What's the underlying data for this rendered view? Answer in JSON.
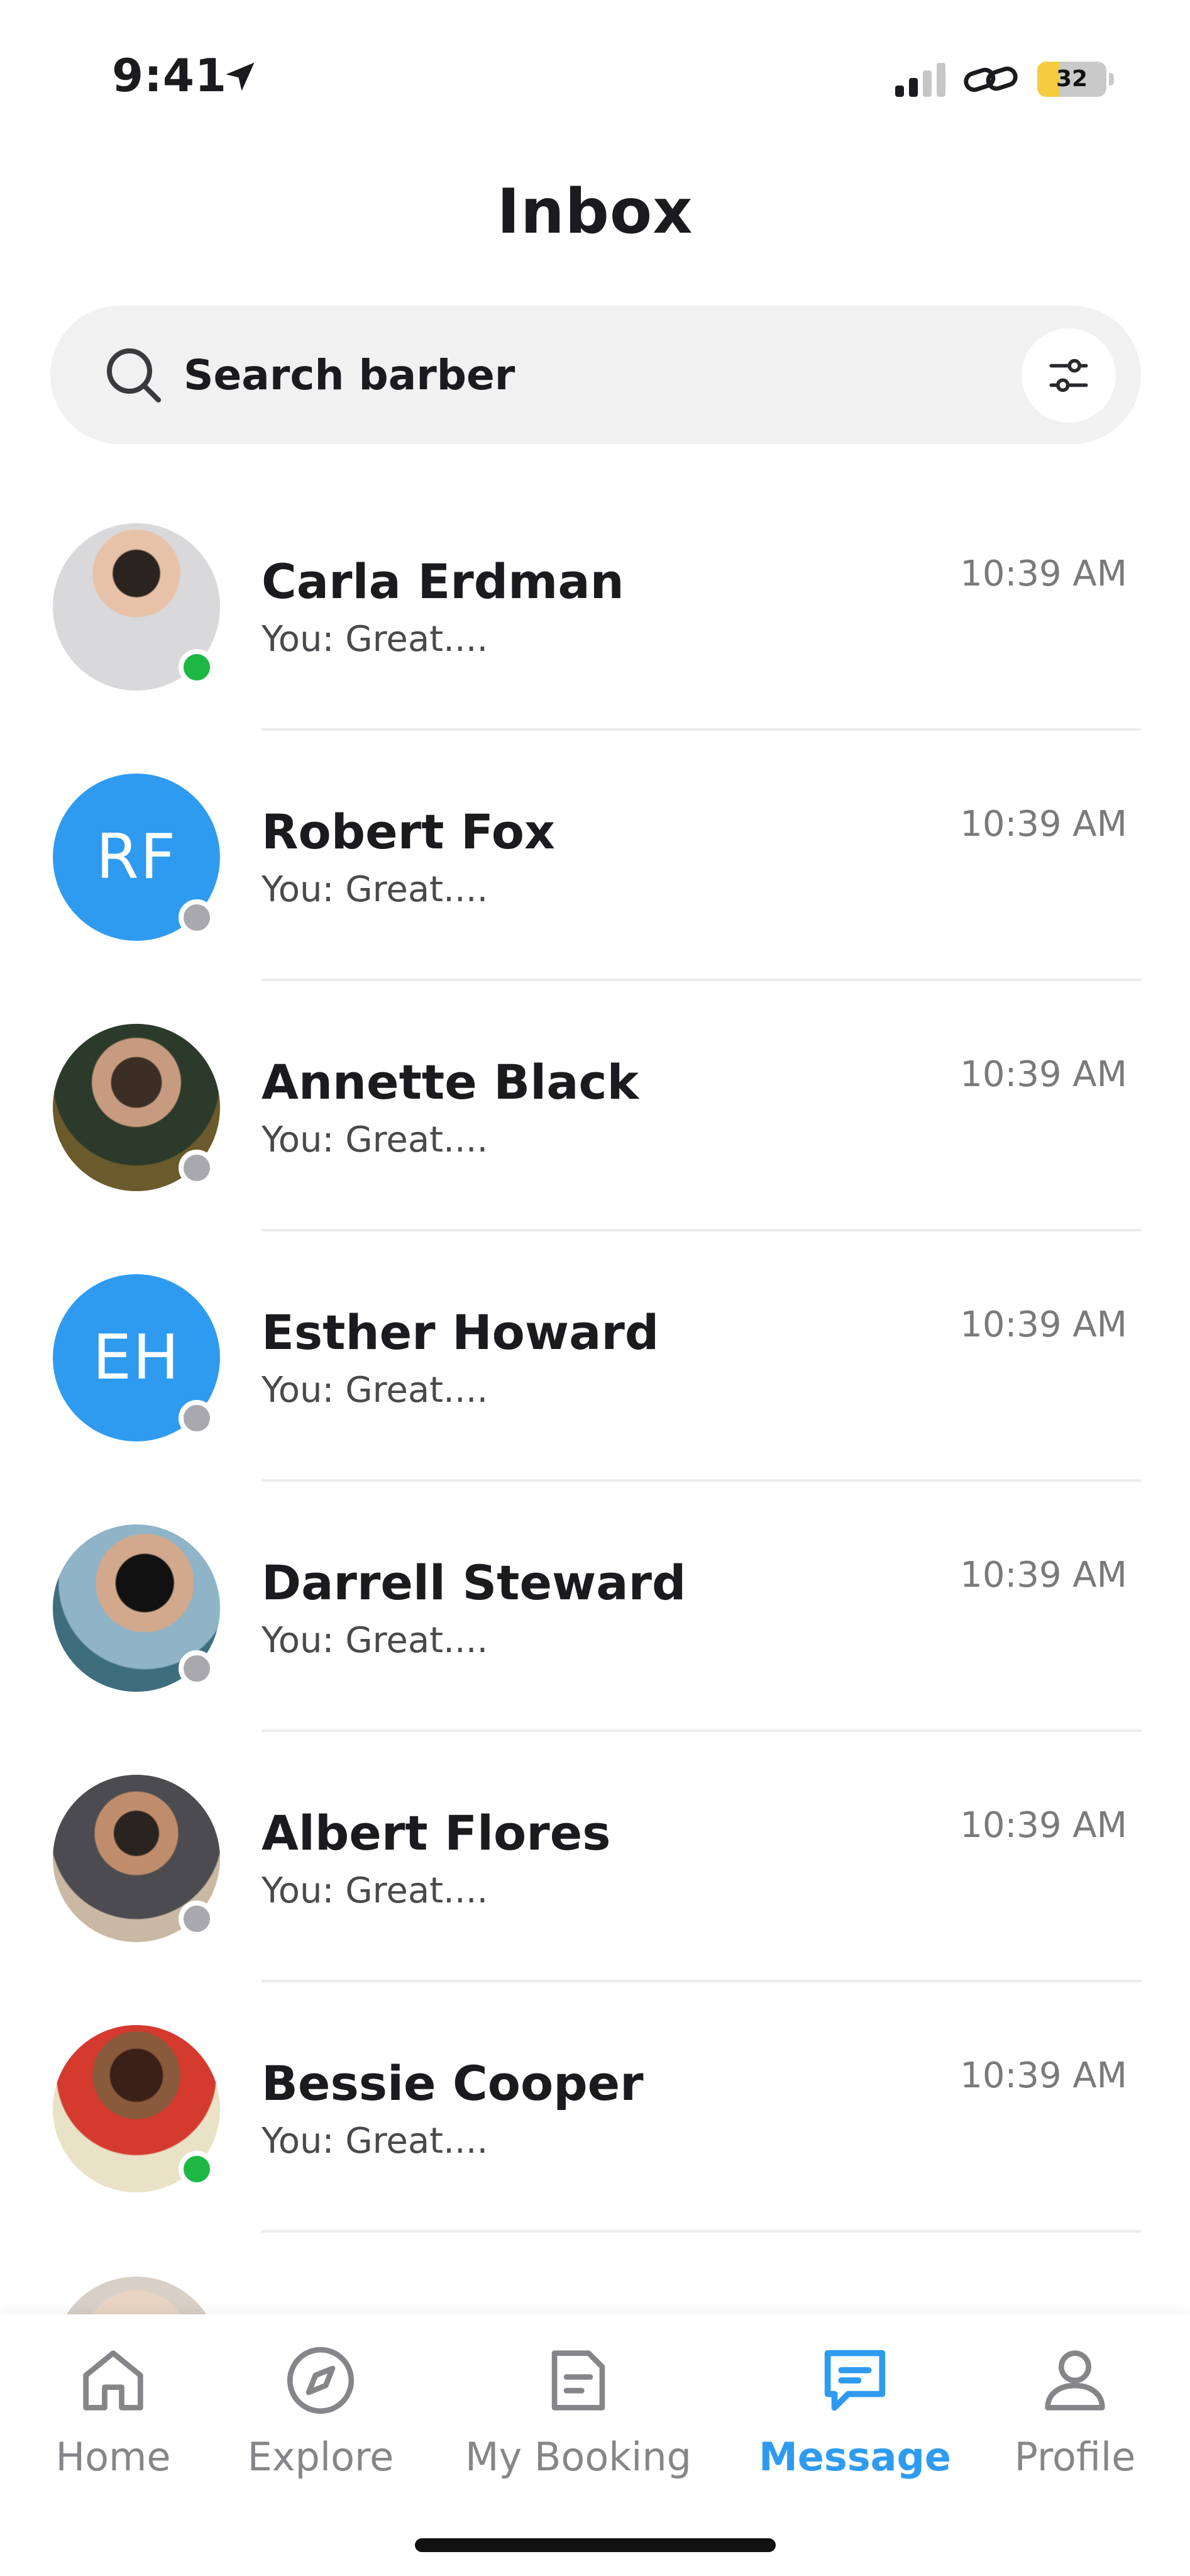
{
  "status_bar": {
    "time": "9:41",
    "battery_level": "32",
    "icons": [
      "location-arrow-icon",
      "cellular-signal-icon",
      "personal-hotspot-link-icon",
      "battery-icon"
    ]
  },
  "header": {
    "title": "Inbox"
  },
  "search": {
    "placeholder": "Search barber",
    "icon": "search-icon",
    "filter_icon": "sliders-filter-icon"
  },
  "conversations": [
    {
      "name": "Carla Erdman",
      "preview": "You: Great....",
      "time": "10:39 AM",
      "avatar": "photo",
      "online": true
    },
    {
      "name": "Robert Fox",
      "preview": "You: Great....",
      "time": "10:39 AM",
      "avatar": "initials",
      "initials": "RF",
      "online": false
    },
    {
      "name": "Annette Black",
      "preview": "You: Great....",
      "time": "10:39 AM",
      "avatar": "photo",
      "online": false
    },
    {
      "name": "Esther Howard",
      "preview": "You: Great....",
      "time": "10:39 AM",
      "avatar": "initials",
      "initials": "EH",
      "online": false
    },
    {
      "name": "Darrell Steward",
      "preview": "You: Great....",
      "time": "10:39 AM",
      "avatar": "photo",
      "online": false
    },
    {
      "name": "Albert Flores",
      "preview": "You: Great....",
      "time": "10:39 AM",
      "avatar": "photo",
      "online": false
    },
    {
      "name": "Bessie Cooper",
      "preview": "You: Great....",
      "time": "10:39 AM",
      "avatar": "photo",
      "online": true
    }
  ],
  "tab_bar": {
    "tabs": [
      {
        "label": "Home",
        "icon": "home-icon",
        "active": false
      },
      {
        "label": "Explore",
        "icon": "compass-icon",
        "active": false
      },
      {
        "label": "My Booking",
        "icon": "document-icon",
        "active": false
      },
      {
        "label": "Message",
        "icon": "chat-bubble-icon",
        "active": true
      },
      {
        "label": "Profile",
        "icon": "user-icon",
        "active": false
      }
    ]
  },
  "colors": {
    "accent": "#2f9bf0",
    "online": "#1db844",
    "offline": "#a9a9ad",
    "inactive_tab": "#86868a",
    "battery": "#f4cc3e"
  }
}
